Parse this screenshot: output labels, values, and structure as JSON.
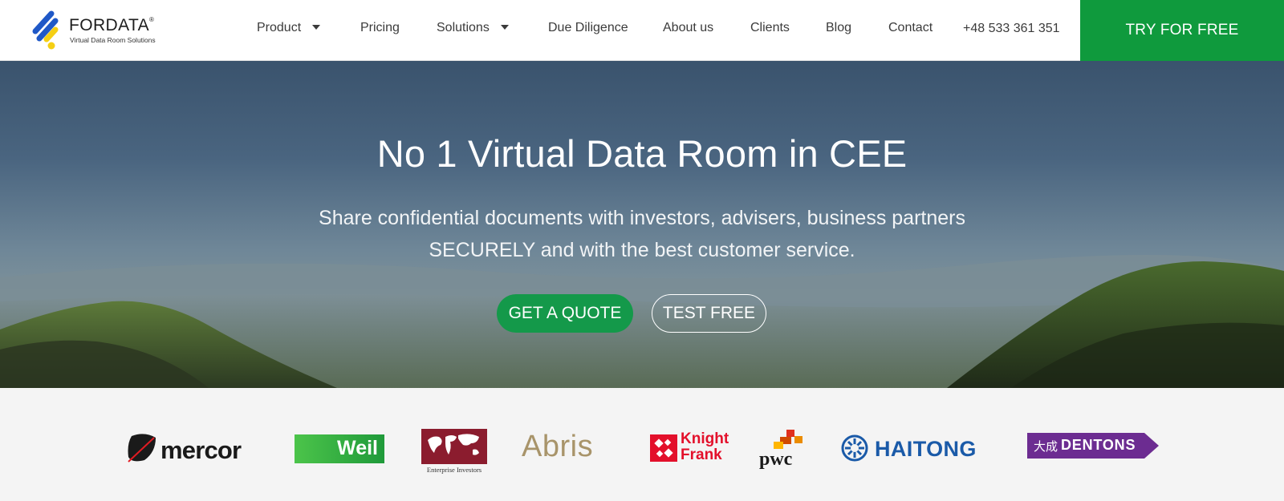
{
  "brand": {
    "name": "FORDATA",
    "tagline": "Virtual Data Room Solutions",
    "colors": {
      "blue": "#1f58c7",
      "yellow": "#f5cf14",
      "green": "#0f9a3d"
    }
  },
  "nav": {
    "items": [
      {
        "label": "Product",
        "dropdown": true
      },
      {
        "label": "Pricing",
        "dropdown": false
      },
      {
        "label": "Solutions",
        "dropdown": true
      },
      {
        "label": "Due Diligence",
        "dropdown": false
      },
      {
        "label": "About us",
        "dropdown": false
      },
      {
        "label": "Clients",
        "dropdown": false
      },
      {
        "label": "Blog",
        "dropdown": false
      },
      {
        "label": "Contact",
        "dropdown": false
      }
    ],
    "phone": "+48 533 361 351",
    "cta": "TRY FOR FREE"
  },
  "hero": {
    "title": "No 1 Virtual Data Room in CEE",
    "subtitle_line1": "Share confidential documents with investors, advisers, business partners",
    "subtitle_line2": "SECURELY and with the best customer service.",
    "primary_button": "GET A QUOTE",
    "secondary_button": "TEST FREE"
  },
  "clients": {
    "mercor": "mercor",
    "weil": "Weil",
    "enterprise": "Enterprise Investors",
    "abris": "Abris",
    "knight_frank_1": "Knight",
    "knight_frank_2": "Frank",
    "pwc": "pwc",
    "haitong": "HAITONG",
    "dentons": "DENTONS",
    "dentons_prefix": "大成"
  }
}
